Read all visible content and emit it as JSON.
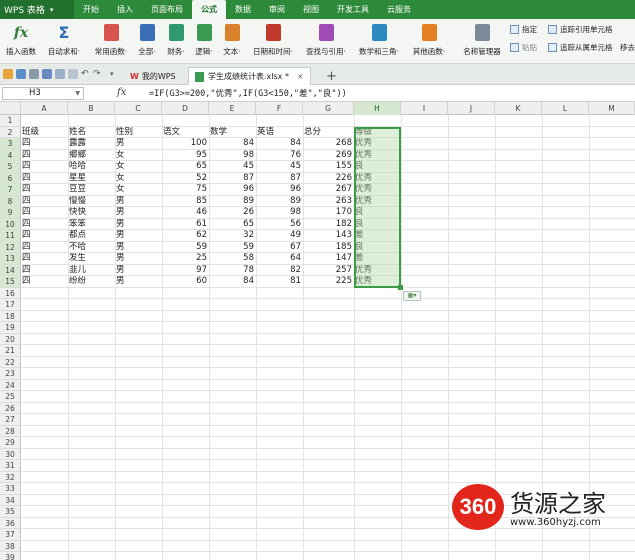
{
  "app": {
    "name": "WPS 表格",
    "colors": {
      "menubar": "#2d8a3a",
      "selection": "#3d9b45"
    }
  },
  "menu": [
    "开始",
    "插入",
    "页面布局",
    "公式",
    "数据",
    "审阅",
    "视图",
    "开发工具",
    "云服务"
  ],
  "active_menu_index": 3,
  "ribbon": {
    "buttons": [
      "插入函数",
      "自动求和·",
      "常用函数·",
      "全部·",
      "财务·",
      "逻辑·",
      "文本·",
      "日期和时间·",
      "查找与引用·",
      "数学和三角·",
      "其他函数·",
      "名称管理器"
    ],
    "side": [
      "指定",
      "粘贴",
      "追踪引用单元格",
      "追踪从属单元格",
      "移去"
    ]
  },
  "tabs": {
    "home": "我的WPS",
    "doc": "学生成绩统计表.xlsx *"
  },
  "formula_bar": {
    "name_box": "H3",
    "fx": "fx",
    "formula": "=IF(G3>=200,\"优秀\",IF(G3<150,\"差\",\"良\"))"
  },
  "columns": [
    "A",
    "B",
    "C",
    "D",
    "E",
    "F",
    "G",
    "H",
    "I",
    "J",
    "K",
    "L",
    "M"
  ],
  "headers": [
    "班级",
    "姓名",
    "性别",
    "语文",
    "数学",
    "英语",
    "总分",
    "等级"
  ],
  "rows": [
    [
      "四",
      "露露",
      "男",
      "100",
      "84",
      "84",
      "268",
      "优秀"
    ],
    [
      "四",
      "鄉鄉",
      "女",
      "95",
      "98",
      "76",
      "269",
      "优秀"
    ],
    [
      "四",
      "哈哈",
      "女",
      "65",
      "45",
      "45",
      "155",
      "良"
    ],
    [
      "四",
      "星星",
      "女",
      "52",
      "87",
      "87",
      "226",
      "优秀"
    ],
    [
      "四",
      "豆豆",
      "女",
      "75",
      "96",
      "96",
      "267",
      "优秀"
    ],
    [
      "四",
      "慢慢",
      "男",
      "85",
      "89",
      "89",
      "263",
      "优秀"
    ],
    [
      "四",
      "快快",
      "男",
      "46",
      "26",
      "98",
      "170",
      "良"
    ],
    [
      "四",
      "笨笨",
      "男",
      "61",
      "65",
      "56",
      "182",
      "良"
    ],
    [
      "四",
      "都点",
      "男",
      "62",
      "32",
      "49",
      "143",
      "差"
    ],
    [
      "四",
      "不哈",
      "男",
      "59",
      "59",
      "67",
      "185",
      "良"
    ],
    [
      "四",
      "发生",
      "男",
      "25",
      "58",
      "64",
      "147",
      "差"
    ],
    [
      "四",
      "韭儿",
      "男",
      "97",
      "78",
      "82",
      "257",
      "优秀"
    ],
    [
      "四",
      "纷纷",
      "男",
      "60",
      "84",
      "81",
      "225",
      "优秀"
    ]
  ],
  "watermark": {
    "badge": "360",
    "title": "货源之家",
    "url": "www.360hyzj.com"
  }
}
